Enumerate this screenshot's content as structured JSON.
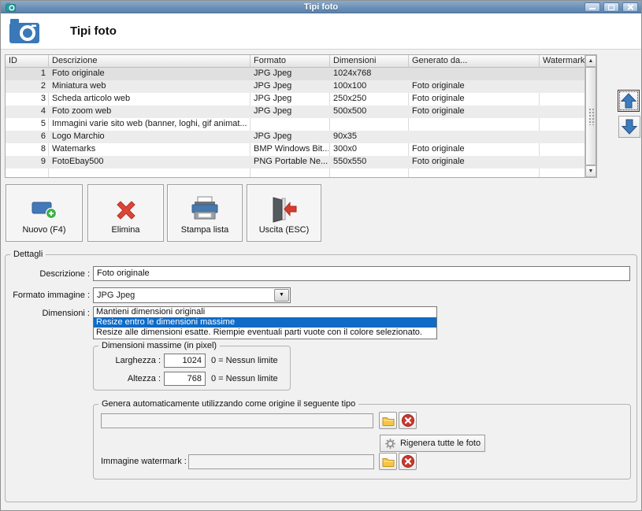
{
  "window": {
    "title": "Tipi foto"
  },
  "header": {
    "title": "Tipi foto"
  },
  "table": {
    "columns": [
      "ID",
      "Descrizione",
      "Formato",
      "Dimensioni",
      "Generato da...",
      "Watermark"
    ],
    "rows": [
      {
        "id": "1",
        "descrizione": "Foto originale",
        "formato": "JPG Jpeg",
        "dimensioni": "1024x768",
        "generato": "",
        "watermark": "",
        "selected": true
      },
      {
        "id": "2",
        "descrizione": "Miniatura web",
        "formato": "JPG Jpeg",
        "dimensioni": "100x100",
        "generato": "Foto originale",
        "watermark": "",
        "selected": false
      },
      {
        "id": "3",
        "descrizione": "Scheda articolo web",
        "formato": "JPG Jpeg",
        "dimensioni": "250x250",
        "generato": "Foto originale",
        "watermark": "",
        "selected": false
      },
      {
        "id": "4",
        "descrizione": "Foto zoom web",
        "formato": "JPG Jpeg",
        "dimensioni": "500x500",
        "generato": "Foto originale",
        "watermark": "",
        "selected": false
      },
      {
        "id": "5",
        "descrizione": "Immagini varie sito web (banner, loghi, gif animat...",
        "formato": "",
        "dimensioni": "",
        "generato": "",
        "watermark": "",
        "selected": false
      },
      {
        "id": "6",
        "descrizione": "Logo Marchio",
        "formato": "JPG Jpeg",
        "dimensioni": "90x35",
        "generato": "",
        "watermark": "",
        "selected": false
      },
      {
        "id": "8",
        "descrizione": "Watemarks",
        "formato": "BMP Windows Bit...",
        "dimensioni": "300x0",
        "generato": "Foto originale",
        "watermark": "",
        "selected": false
      },
      {
        "id": "9",
        "descrizione": "FotoEbay500",
        "formato": "PNG Portable Ne...",
        "dimensioni": "550x550",
        "generato": "Foto originale",
        "watermark": "",
        "selected": false
      }
    ]
  },
  "toolbar": {
    "buttons": [
      {
        "label": "Nuovo (F4)",
        "icon": "new-photo-type-icon"
      },
      {
        "label": "Elimina",
        "icon": "delete-icon"
      },
      {
        "label": "Stampa lista",
        "icon": "printer-icon"
      },
      {
        "label": "Uscita (ESC)",
        "icon": "exit-door-icon"
      }
    ]
  },
  "details": {
    "legend": "Dettagli",
    "descrizione_label": "Descrizione :",
    "descrizione_value": "Foto originale",
    "formato_label": "Formato immagine :",
    "formato_value": "JPG Jpeg",
    "dimensioni_label": "Dimensioni :",
    "dimensioni_options": [
      {
        "label": "Mantieni dimensioni originali",
        "selected": false
      },
      {
        "label": "Resize entro le dimensioni massime",
        "selected": true
      },
      {
        "label": "Resize alle dimensioni esatte. Riempie eventuali parti vuote con il colore selezionato.",
        "selected": false
      }
    ],
    "max_dim": {
      "legend": "Dimensioni massime (in pixel)",
      "larghezza_label": "Larghezza :",
      "larghezza_value": "1024",
      "altezza_label": "Altezza :",
      "altezza_value": "768",
      "hint": "0 = Nessun limite"
    },
    "genera": {
      "legend": "Genera automaticamente utilizzando come origine il seguente tipo",
      "source_value": "",
      "rigenera_label": "Rigenera tutte le foto",
      "watermark_label": "Immagine watermark :",
      "watermark_value": ""
    }
  },
  "colors": {
    "titlebar_top": "#8cabc9",
    "titlebar_bottom": "#5d84ad",
    "accent_blue": "#3a78b8",
    "selection_blue": "#0f6bc6",
    "delete_red": "#dc4639",
    "folder_yellow": "#f6c544",
    "add_green": "#3fae49",
    "row_stripe": "#ececec",
    "row_selected": "#e0e0e0"
  }
}
